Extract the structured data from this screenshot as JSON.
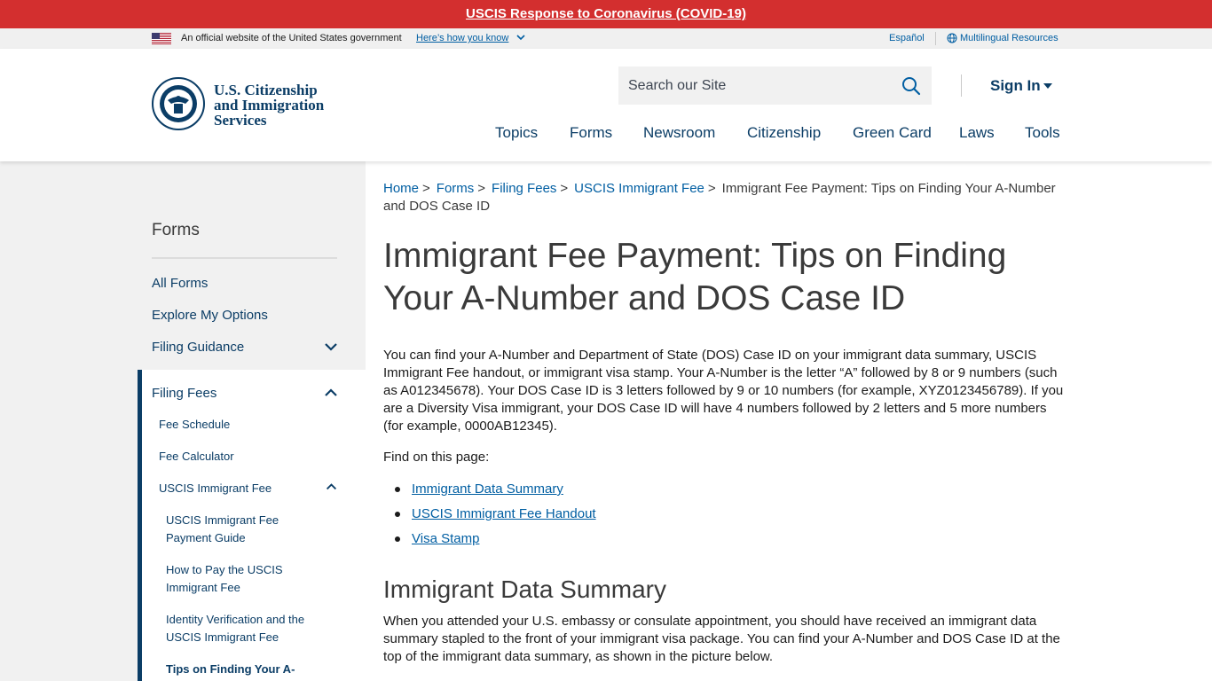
{
  "alert": {
    "text": "USCIS Response to Coronavirus (COVID-19)"
  },
  "gov_banner": {
    "official": "An official website of the United States government",
    "how_you_know": "Here’s how you know",
    "espanol": "Español",
    "multilingual": "Multilingual Resources"
  },
  "header": {
    "logo_line1": "U.S. Citizenship",
    "logo_line2": "and Immigration",
    "logo_line3": "Services",
    "search_placeholder": "Search our Site",
    "sign_in": "Sign In",
    "nav": [
      "Topics",
      "Forms",
      "Newsroom",
      "Citizenship",
      "Green Card",
      "Laws",
      "Tools"
    ]
  },
  "sidebar": {
    "title": "Forms",
    "items": [
      {
        "label": "All Forms"
      },
      {
        "label": "Explore My Options"
      },
      {
        "label": "Filing Guidance"
      }
    ],
    "panel_title": "Filing Fees",
    "sub_items": [
      {
        "label": "Fee Schedule"
      },
      {
        "label": "Fee Calculator"
      },
      {
        "label": "USCIS Immigrant Fee"
      }
    ],
    "sub_sub_items": [
      {
        "label": "USCIS Immigrant Fee Payment Guide"
      },
      {
        "label": "How to Pay the USCIS Immigrant Fee"
      },
      {
        "label": "Identity Verification and the USCIS Immigrant Fee"
      },
      {
        "label": "Tips on Finding Your A-"
      }
    ]
  },
  "breadcrumb": {
    "items": [
      "Home",
      "Forms",
      "Filing Fees",
      "USCIS Immigrant Fee"
    ],
    "current": "Immigrant Fee Payment: Tips on Finding Your A-Number and DOS Case ID"
  },
  "page": {
    "title": "Immigrant Fee Payment: Tips on Finding Your A-Number and DOS Case ID",
    "intro": "You can find your A-Number and Department of State (DOS) Case ID on your immigrant data summary, USCIS Immigrant Fee handout, or immigrant visa stamp. Your A-Number is the letter “A” followed by 8 or 9 numbers (such as A012345678). Your DOS Case ID is 3 letters followed by 9 or 10 numbers (for example, XYZ0123456789). If you are a Diversity Visa immigrant, your DOS Case ID will have 4 numbers followed by 2 letters and 5 more numbers (for example, 0000AB12345).",
    "find_label": "Find on this page:",
    "toc": [
      "Immigrant Data Summary",
      "USCIS Immigrant Fee Handout",
      "Visa Stamp"
    ],
    "section_title": "Immigrant Data Summary",
    "section_body": "When you attended your U.S. embassy or consulate appointment, you should have received an immigrant data summary stapled to the front of your immigrant visa package. You can find your A-Number and DOS Case ID at the top of the immigrant data summary, as shown in the picture below."
  },
  "colors": {
    "alert_red": "#d32f2f",
    "brand_navy": "#0b3d66",
    "link_blue": "#005ea2"
  },
  "icons": [
    "us-flag-icon",
    "chevron-down-icon",
    "globe-icon",
    "dhs-seal-icon",
    "search-icon",
    "caret-down-icon",
    "chevron-up-icon"
  ]
}
